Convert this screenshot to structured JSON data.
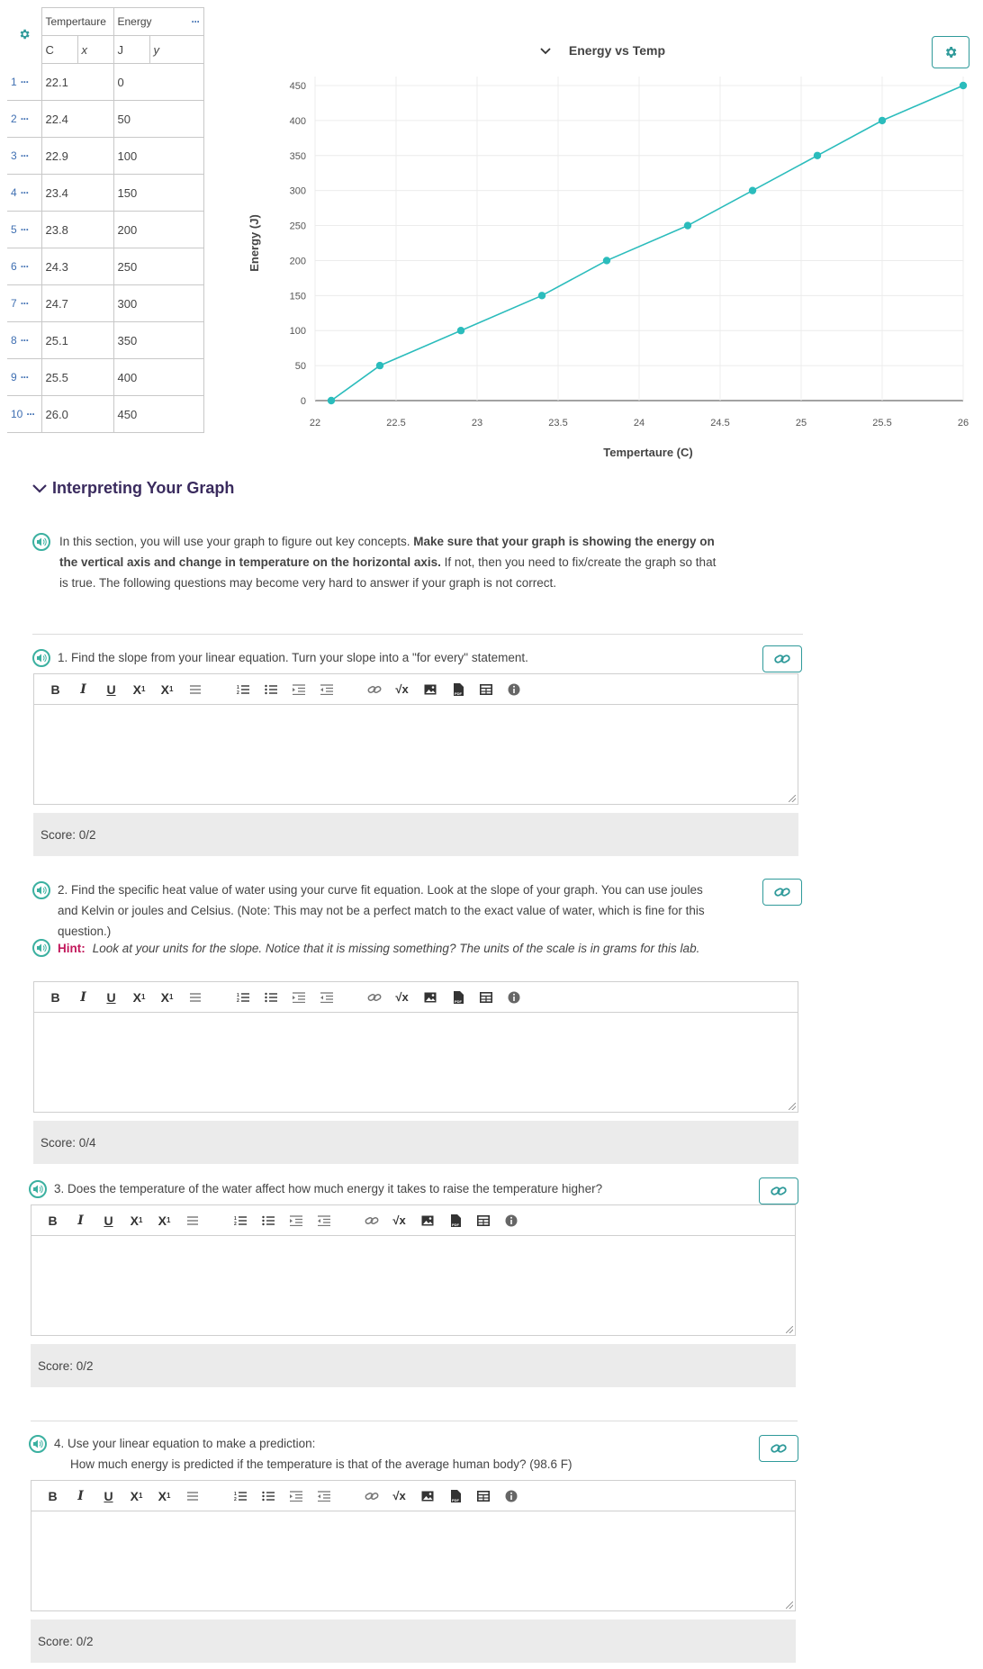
{
  "table": {
    "columns": [
      {
        "name": "Tempertaure",
        "unit": "C",
        "var": "x"
      },
      {
        "name": "Energy",
        "unit": "J",
        "var": "y"
      }
    ],
    "rows": [
      {
        "n": "1",
        "temp": "22.1",
        "energy": "0"
      },
      {
        "n": "2",
        "temp": "22.4",
        "energy": "50"
      },
      {
        "n": "3",
        "temp": "22.9",
        "energy": "100"
      },
      {
        "n": "4",
        "temp": "23.4",
        "energy": "150"
      },
      {
        "n": "5",
        "temp": "23.8",
        "energy": "200"
      },
      {
        "n": "6",
        "temp": "24.3",
        "energy": "250"
      },
      {
        "n": "7",
        "temp": "24.7",
        "energy": "300"
      },
      {
        "n": "8",
        "temp": "25.1",
        "energy": "350"
      },
      {
        "n": "9",
        "temp": "25.5",
        "energy": "400"
      },
      {
        "n": "10",
        "temp": "26.0",
        "energy": "450"
      }
    ]
  },
  "chart_data": {
    "type": "line",
    "title": "Energy vs Temp",
    "xlabel": "Tempertaure (C)",
    "ylabel": "Energy (J)",
    "x": [
      22.1,
      22.4,
      22.9,
      23.4,
      23.8,
      24.3,
      24.7,
      25.1,
      25.5,
      26.0
    ],
    "series": [
      {
        "values": [
          0,
          50,
          100,
          150,
          200,
          250,
          300,
          350,
          400,
          450
        ]
      }
    ],
    "xlim": [
      22,
      26
    ],
    "ylim": [
      0,
      450
    ],
    "x_ticks": [
      "22",
      "22.5",
      "23",
      "23.5",
      "24",
      "24.5",
      "25",
      "25.5",
      "26"
    ],
    "y_ticks": [
      "0",
      "50",
      "100",
      "150",
      "200",
      "250",
      "300",
      "350",
      "400",
      "450"
    ],
    "grid": true,
    "color": "#2bbcbc"
  },
  "section": {
    "heading": "Interpreting Your Graph",
    "intro_part1": "In this section, you will use your graph to figure out key concepts. ",
    "intro_bold": "Make sure that your graph is showing the energy on the vertical axis and change in temperature on the horizontal axis.",
    "intro_part2": " If not, then you need to fix/create the graph so that is true. The following questions may become very hard to answer if your graph is not correct."
  },
  "questions": [
    {
      "text": "1. Find the slope from your linear equation. Turn your slope into a \"for every\" statement.",
      "score": "Score: 0/2"
    },
    {
      "text": "2. Find the specific heat value of water using your curve fit equation. Look at the slope of your graph. You can use joules and Kelvin or joules and Celsius. (Note: This may not be a perfect match to the exact value of water, which is fine for this question.)",
      "score": "Score: 0/4",
      "hint_label": "Hint:",
      "hint_text": "Look at your units for the slope. Notice that it is missing something? The units of the scale is in grams for this lab."
    },
    {
      "text": "3. Does the temperature of the water affect how much energy it takes to raise the temperature higher?",
      "score": "Score: 0/2"
    },
    {
      "text": "4. Use your linear equation to make a prediction:",
      "text2": "How much energy is predicted if the temperature is that of the average human body? (98.6 F)",
      "score": "Score: 0/2"
    }
  ],
  "toolbar": [
    "bold",
    "italic",
    "underline",
    "subscript",
    "superscript",
    "align",
    "ordered-list",
    "bullet-list",
    "indent",
    "outdent",
    "link",
    "math",
    "image",
    "pdf",
    "table",
    "info"
  ]
}
